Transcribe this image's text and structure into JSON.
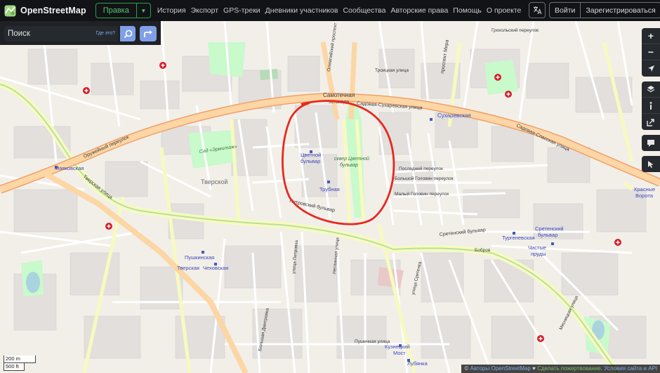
{
  "header": {
    "brand": "OpenStreetMap",
    "edit_label": "Правка",
    "nav": [
      "История",
      "Экспорт",
      "GPS-треки",
      "Дневники участников",
      "Сообщества",
      "Авторские права",
      "Помощь",
      "О проекте"
    ],
    "login": "Войти",
    "signup": "Зарегистрироваться"
  },
  "search": {
    "placeholder": "Поиск",
    "where_label": "Где это?"
  },
  "controls": [
    "zoom-in",
    "zoom-out",
    "locate",
    "layers",
    "info",
    "share",
    "note",
    "query"
  ],
  "map": {
    "colors": {
      "land": "#f2efe9",
      "residential": "#e0dfdf",
      "trunk": "#fcd6a4",
      "primary": "#f7fabf",
      "park": "#c8facc",
      "annotation": "#e8281e"
    },
    "labels": {
      "samotechnaya_1": "Самотечная",
      "samotechnaya_2": "эстакада",
      "sukharevskaya_str": "Садовая-Сухаревская улица",
      "sukharevskaya_st": "Сухаревская",
      "sadovaya_spasskaya": "Садовая-Спасская улица",
      "oruzheyny": "Оружейный переулок",
      "mayakovskaya": "Маяковская",
      "tverskaya_str": "Тверская улица",
      "tverskoy": "Тверской",
      "hermitage": "Сад «Эрмитаж»",
      "tsvetnoy_1": "Цветной",
      "tsvetnoy_2": "бульвар",
      "sq_tsvetnoy_1": "сквер Цветной",
      "sq_tsvetnoy_2": "бульвар",
      "trubnaya": "Трубная",
      "petrovsky": "Петровский бульвар",
      "posledny": "Последний переулок",
      "golovin_bolshoy": "Большой Головин переулок",
      "golovin_maly": "Малый Головин переулок",
      "sretensky_bulvar": "Сретенский бульвар",
      "sretensky_st_1": "Сретенский",
      "sretensky_st_2": "бульвар",
      "turgenevskaya": "Тургеневская",
      "chistye_1": "Чистые",
      "chistye_2": "пруды",
      "krasnye_1": "Красные",
      "krasnye_2": "Ворота",
      "pushkinskaya": "Пушкинская",
      "tverskaya_st": "Тверская",
      "chekhovskaya": "Чеховская",
      "kuznetsky_1": "Кузнецкий",
      "kuznetsky_2": "Мост",
      "lubyanka": "Лубянка",
      "prospekt_mira": "проспект Мира",
      "grokholsky": "Грохольский переулок",
      "troitskaya": "Троицкая улица",
      "olimpiysky": "Олимпийский проспект",
      "myasnitskaya": "Мясницкая улица",
      "pushechnaya": "Пушечная улица",
      "bolshaya_dmitrovka": "Большая Дмитровка",
      "petrovka": "улица Петровка",
      "neglinnaya": "Неглинная улица",
      "sretenka": "улица Сретенка",
      "bobrov": "Бобров"
    }
  },
  "scale": {
    "metric": "200 m",
    "imperial": "500 ft"
  },
  "attribution": {
    "prefix": "© ",
    "authors": "Авторы OpenStreetMap",
    "heart": " ♥ ",
    "donate": "Сделать пожертвование",
    "sep": ". ",
    "terms": "Условия сайта и API"
  }
}
